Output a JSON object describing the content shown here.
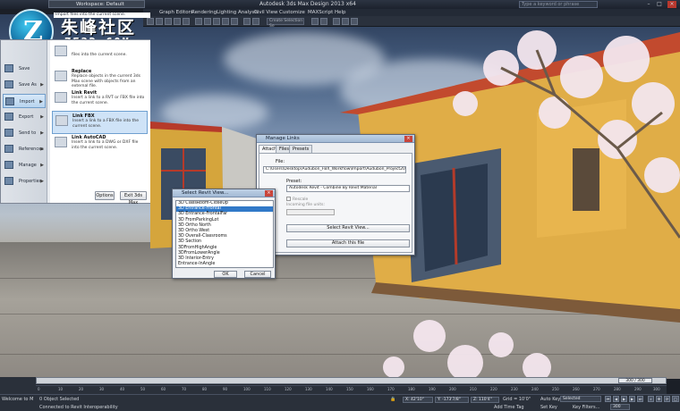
{
  "window": {
    "title": "Autodesk 3ds Max Design 2013 x64",
    "search_placeholder": "Type a keyword or phrase",
    "workspace": "Workspace: Default"
  },
  "menubar": [
    "Graph Editors",
    "Rendering",
    "Lighting Analysis",
    "Civil View",
    "Customize",
    "MAXScript",
    "Help"
  ],
  "toolbar": {
    "selection_set": "Create Selection Se"
  },
  "logo": {
    "cn": "朱峰社区",
    "en": "ZF3D.COM"
  },
  "app_menu": {
    "left_items": [
      {
        "label": "Save",
        "arrow": ""
      },
      {
        "label": "Save As",
        "arrow": "▶"
      },
      {
        "label": "Import",
        "arrow": "▶"
      },
      {
        "label": "Export",
        "arrow": "▶"
      },
      {
        "label": "Send to",
        "arrow": "▶"
      },
      {
        "label": "References",
        "arrow": "▶"
      },
      {
        "label": "Manage",
        "arrow": "▶"
      },
      {
        "label": "Properties",
        "arrow": "▶"
      }
    ],
    "header": "Import files into the current scene.",
    "right_items": [
      {
        "name": "",
        "desc": "files into the current scene."
      },
      {
        "name": "Replace",
        "desc": "Replace objects in the current 3ds Max scene with objects from an external file."
      },
      {
        "name": "Link Revit",
        "desc": "Insert a link to a RVT or FBX file into the current scene."
      },
      {
        "name": "Link FBX",
        "desc": "Insert a link to a FBX file into the current scene."
      },
      {
        "name": "Link AutoCAD",
        "desc": "Insert a link to a DWG or DXF file into the current scene."
      }
    ],
    "options_label": "Options",
    "exit_label": "Exit 3ds Max"
  },
  "manage_links": {
    "title": "Manage Links",
    "tabs": [
      "Attach",
      "Files",
      "Presets"
    ],
    "file_label": "File:",
    "file_path": "C:\\Users\\Desktop\\Audubon_FBX_Workflow\\Import\\Audubon_Project2013.rvt",
    "preset_label": "Preset:",
    "preset_value": "Autodesk Revit - Combine By Revit Material",
    "rescale_label": "Rescale",
    "units_label": "Incoming file units:",
    "select_view_label": "Select Revit View...",
    "attach_label": "Attach this file"
  },
  "revit_view": {
    "title": "Select Revit View...",
    "items": [
      "3D ClassRoom-CloseUp",
      "3D Entrance-Frontal",
      "3D Entrance-FrontalFar",
      "3D FromParkingLot",
      "3D Ortho North",
      "3D Ortho West",
      "3D Overall-Classrooms",
      "3D Section",
      "3DFromHighAngle",
      "3DFromLowerAngle",
      "3D Interior-Entry",
      "Entrance-InAngle"
    ],
    "selected_index": 1,
    "ok_label": "OK",
    "cancel_label": "Cancel"
  },
  "timeline": {
    "slider_label": "300 / 300",
    "ticks": [
      "0",
      "10",
      "20",
      "30",
      "40",
      "50",
      "60",
      "70",
      "80",
      "90",
      "100",
      "110",
      "120",
      "130",
      "140",
      "150",
      "160",
      "170",
      "180",
      "190",
      "200",
      "210",
      "220",
      "230",
      "240",
      "250",
      "260",
      "270",
      "280",
      "290",
      "300"
    ]
  },
  "status": {
    "welcome": "Welcome to M",
    "objects_selected": "0 Object Selected",
    "prompt": "Connected to Revit Interoperability",
    "x": "X: 42'10\"",
    "y": "Y: -173'7/8\"",
    "z": "Z: 110'4\"",
    "grid": "Grid = 10'0\"",
    "add_time_tag": "Add Time Tag",
    "auto_key": "Auto Key",
    "set_key": "Set Key",
    "selected": "Selected",
    "key_filters": "Key Filters...",
    "frame": "300"
  }
}
